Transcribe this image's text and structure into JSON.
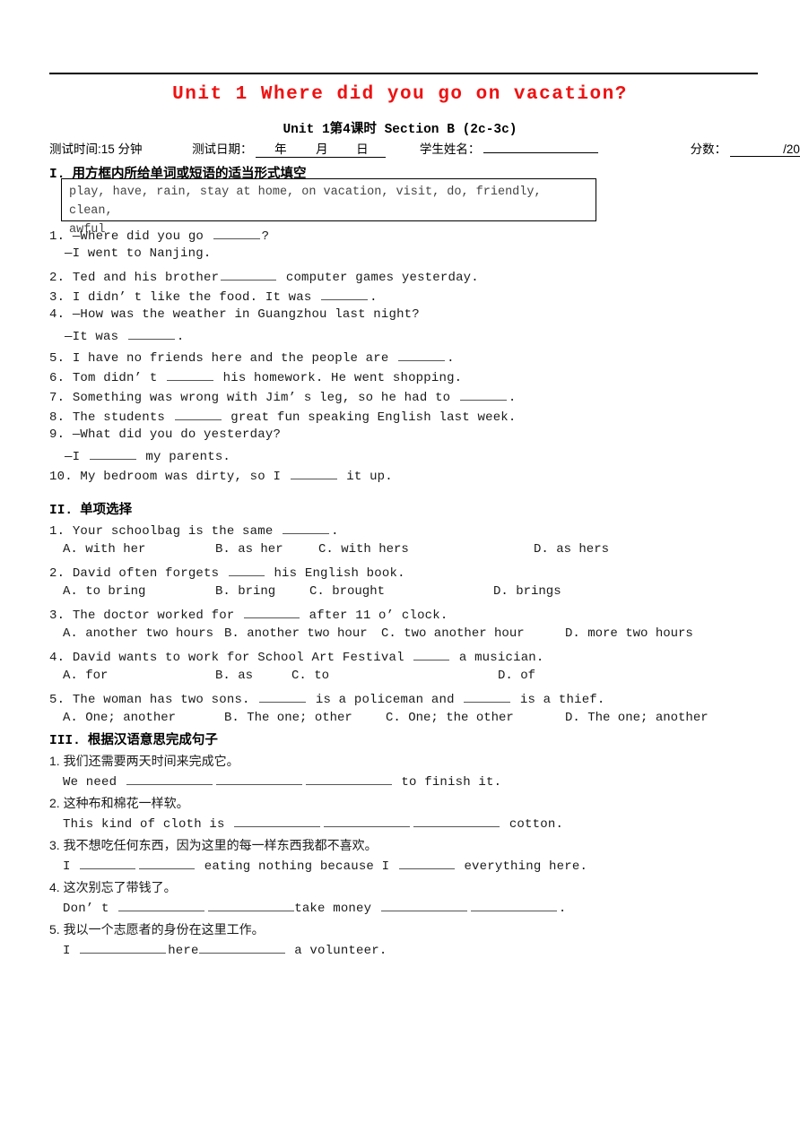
{
  "document": {
    "title": "Unit 1 Where did you go on vacation?",
    "subtitle": "Unit 1第4课时 Section B (2c-3c)",
    "title_color": "#ee1111"
  },
  "info": {
    "test_time_label": "测试时间:15 分钟",
    "test_date_label": "测试日期：",
    "date_year": "年",
    "date_month": "月",
    "date_day": "日",
    "student_name_label": "学生姓名：",
    "student_name_value": "",
    "score_label": "分数：",
    "score_value": "",
    "score_total": "/20"
  },
  "section1": {
    "roman": "I.",
    "heading": "用方框内所给单词或短语的适当形式填空",
    "wordbank_line1": "play, have, rain, stay at home, on vacation, visit, do, friendly, clean,",
    "wordbank_line2": "awful",
    "items": [
      {
        "num": "1.",
        "pre": "—Where did you go ",
        "blank": "s",
        "post": "?"
      },
      {
        "num": "",
        "pre": "—I went to Nanjing.",
        "blank": "",
        "post": ""
      },
      {
        "num": "2.",
        "pre": "Ted and his brother",
        "blank": "s",
        "post": " computer games yesterday."
      },
      {
        "num": "3.",
        "pre": "I didn’ t like the food. It was ",
        "blank": "s",
        "post": "."
      },
      {
        "num": "4.",
        "pre": "—How was the weather in Guangzhou last night?",
        "blank": "",
        "post": ""
      },
      {
        "num": "",
        "pre": "—It was ",
        "blank": "s",
        "post": "."
      },
      {
        "num": "5.",
        "pre": "I have no friends here and the people are ",
        "blank": "s",
        "post": "."
      },
      {
        "num": "6.",
        "pre": "Tom didn’ t ",
        "blank": "s",
        "post": " his homework. He went shopping."
      },
      {
        "num": "7.",
        "pre": "Something was wrong with Jim’ s leg, so he had to ",
        "blank": "s",
        "post": "."
      },
      {
        "num": "8.",
        "pre": "The students ",
        "blank": "s",
        "post": " great fun speaking English last week."
      },
      {
        "num": "9.",
        "pre": "—What did you do yesterday?",
        "blank": "",
        "post": ""
      },
      {
        "num": "",
        "pre": "—I ",
        "blank": "s",
        "post": " my parents."
      },
      {
        "num": "10.",
        "pre": "My bedroom was dirty, so I ",
        "blank": "s",
        "post": " it up."
      }
    ]
  },
  "section2": {
    "roman": "II.",
    "heading": "单项选择",
    "questions": [
      {
        "num": "1.",
        "pre": "Your schoolbag is the same ",
        "post": ".",
        "options": [
          "A. with her",
          "B. as her",
          "C. with hers",
          "D. as hers"
        ]
      },
      {
        "num": "2.",
        "pre": "David often forgets ",
        "post": " his English book.",
        "options": [
          "A. to bring",
          "B. bring",
          "C. brought",
          "D. brings"
        ]
      },
      {
        "num": "3.",
        "pre": "The doctor worked for ",
        "post": " after 11 o’ clock.",
        "options": [
          "A. another two hours",
          "B. another two hour",
          "C. two another hour",
          "D. more two hours"
        ]
      },
      {
        "num": "4.",
        "pre": "David wants to work for School Art Festival ",
        "post": " a musician.",
        "options": [
          "A. for",
          "B. as",
          "C. to",
          "D. of"
        ]
      },
      {
        "num": "5.",
        "pre": "The woman has two sons. ",
        "mid": " is a policeman and ",
        "post": " is a thief.",
        "options": [
          "A. One; another",
          "B. The one; other",
          "C. One; the other",
          "D. The one; another"
        ]
      }
    ]
  },
  "section3": {
    "roman": "III.",
    "heading": "根据汉语意思完成句子",
    "questions": [
      {
        "num": "1.",
        "chinese": "我们还需要两天时间来完成它。",
        "en_pre": "We need ",
        "en_post": " to finish it."
      },
      {
        "num": "2.",
        "chinese": "这种布和棉花一样软。",
        "en_pre": "This kind of cloth is ",
        "en_post": " cotton."
      },
      {
        "num": "3.",
        "chinese": "我不想吃任何东西，因为这里的每一样东西我都不喜欢。",
        "en_pre": "I ",
        "en_mid": " eating nothing because I ",
        "en_post": " everything here."
      },
      {
        "num": "4.",
        "chinese": "这次别忘了带钱了。",
        "en_pre": "Don’ t ",
        "en_mid": "take money ",
        "en_post": "."
      },
      {
        "num": "5.",
        "chinese": "我以一个志愿者的身份在这里工作。",
        "en_pre": "I ",
        "en_mid": "here",
        "en_post": " a volunteer."
      }
    ]
  }
}
